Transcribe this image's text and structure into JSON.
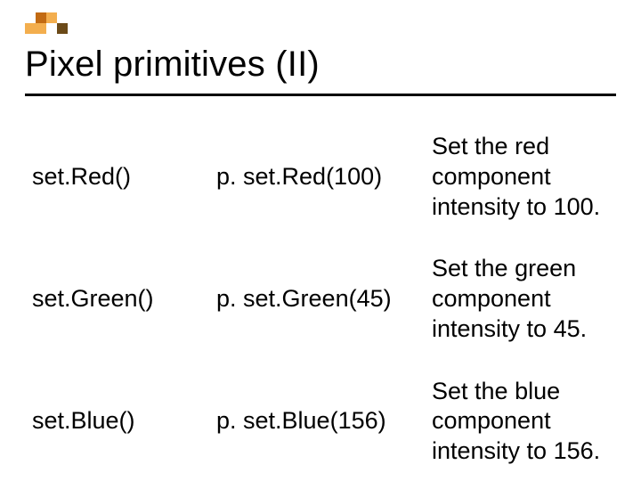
{
  "colors": {
    "orange_dark": "#c26a12",
    "orange_light": "#f3ae4e",
    "brown": "#6b4a18"
  },
  "title": "Pixel primitives (II)",
  "rows": [
    {
      "method": "set.Red()",
      "example": "p. set.Red(100)",
      "description": "Set the red component intensity to 100."
    },
    {
      "method": "set.Green()",
      "example": "p. set.Green(45)",
      "description": "Set the green component intensity to 45."
    },
    {
      "method": "set.Blue()",
      "example": "p. set.Blue(156)",
      "description": "Set the blue component intensity to 156."
    }
  ]
}
